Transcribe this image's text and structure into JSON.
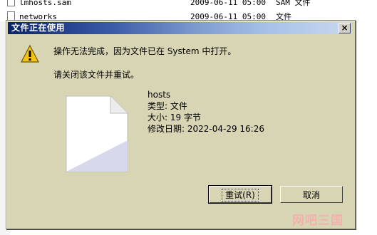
{
  "background": {
    "rows": [
      {
        "name": "lmhosts.sam",
        "date": "2009-06-11 05:00",
        "type": "SAM 文件"
      },
      {
        "name": "networks",
        "date": "2009-06-11 05:00",
        "type": "文件"
      }
    ]
  },
  "dialog": {
    "title": "文件正在使用",
    "close_label": "×",
    "message": "操作无法完成，因为文件已在 System 中打开。",
    "instruction": "请关闭该文件并重试。",
    "file": {
      "name": "hosts",
      "type_line": "类型: 文件",
      "size_line": "大小: 19 字节",
      "modified_line": "修改日期: 2022-04-29 16:26"
    },
    "buttons": {
      "retry": "重试(R)",
      "cancel": "取消"
    }
  },
  "watermark": "网吧三国",
  "colors": {
    "dialog_bg": "#d7d5b4",
    "title_start": "#0a246a",
    "title_end": "#c9d8ee"
  }
}
